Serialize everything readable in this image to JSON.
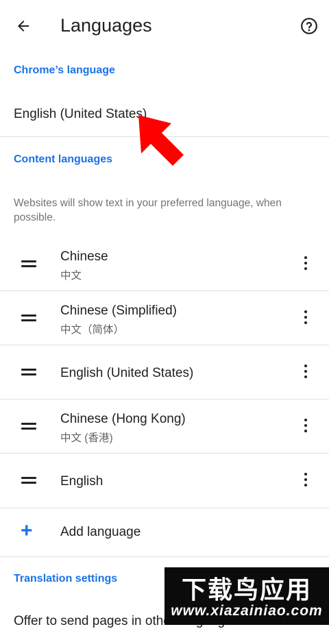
{
  "header": {
    "title": "Languages",
    "back_icon": "arrow-left-icon",
    "help_icon": "help-circle-icon"
  },
  "chrome_language": {
    "section_title": "Chrome’s language",
    "value": "English (United States)"
  },
  "content_languages": {
    "section_title": "Content languages",
    "description": "Websites will show text in your preferred language, when possible.",
    "items": [
      {
        "name": "Chinese",
        "native": "中文"
      },
      {
        "name": "Chinese (Simplified)",
        "native": "中文（简体）"
      },
      {
        "name": "English (United States)",
        "native": ""
      },
      {
        "name": "Chinese (Hong Kong)",
        "native": "中文 (香港)"
      },
      {
        "name": "English",
        "native": ""
      }
    ],
    "add_label": "Add language"
  },
  "translation": {
    "section_title": "Translation settings",
    "cutoff_text": "Offer to send pages in other languages to"
  },
  "watermark": {
    "main": "下载鸟应用",
    "url": "www.xiazainiao.com"
  },
  "colors": {
    "accent": "#1a73e8",
    "annotation_arrow": "#ff0000"
  }
}
